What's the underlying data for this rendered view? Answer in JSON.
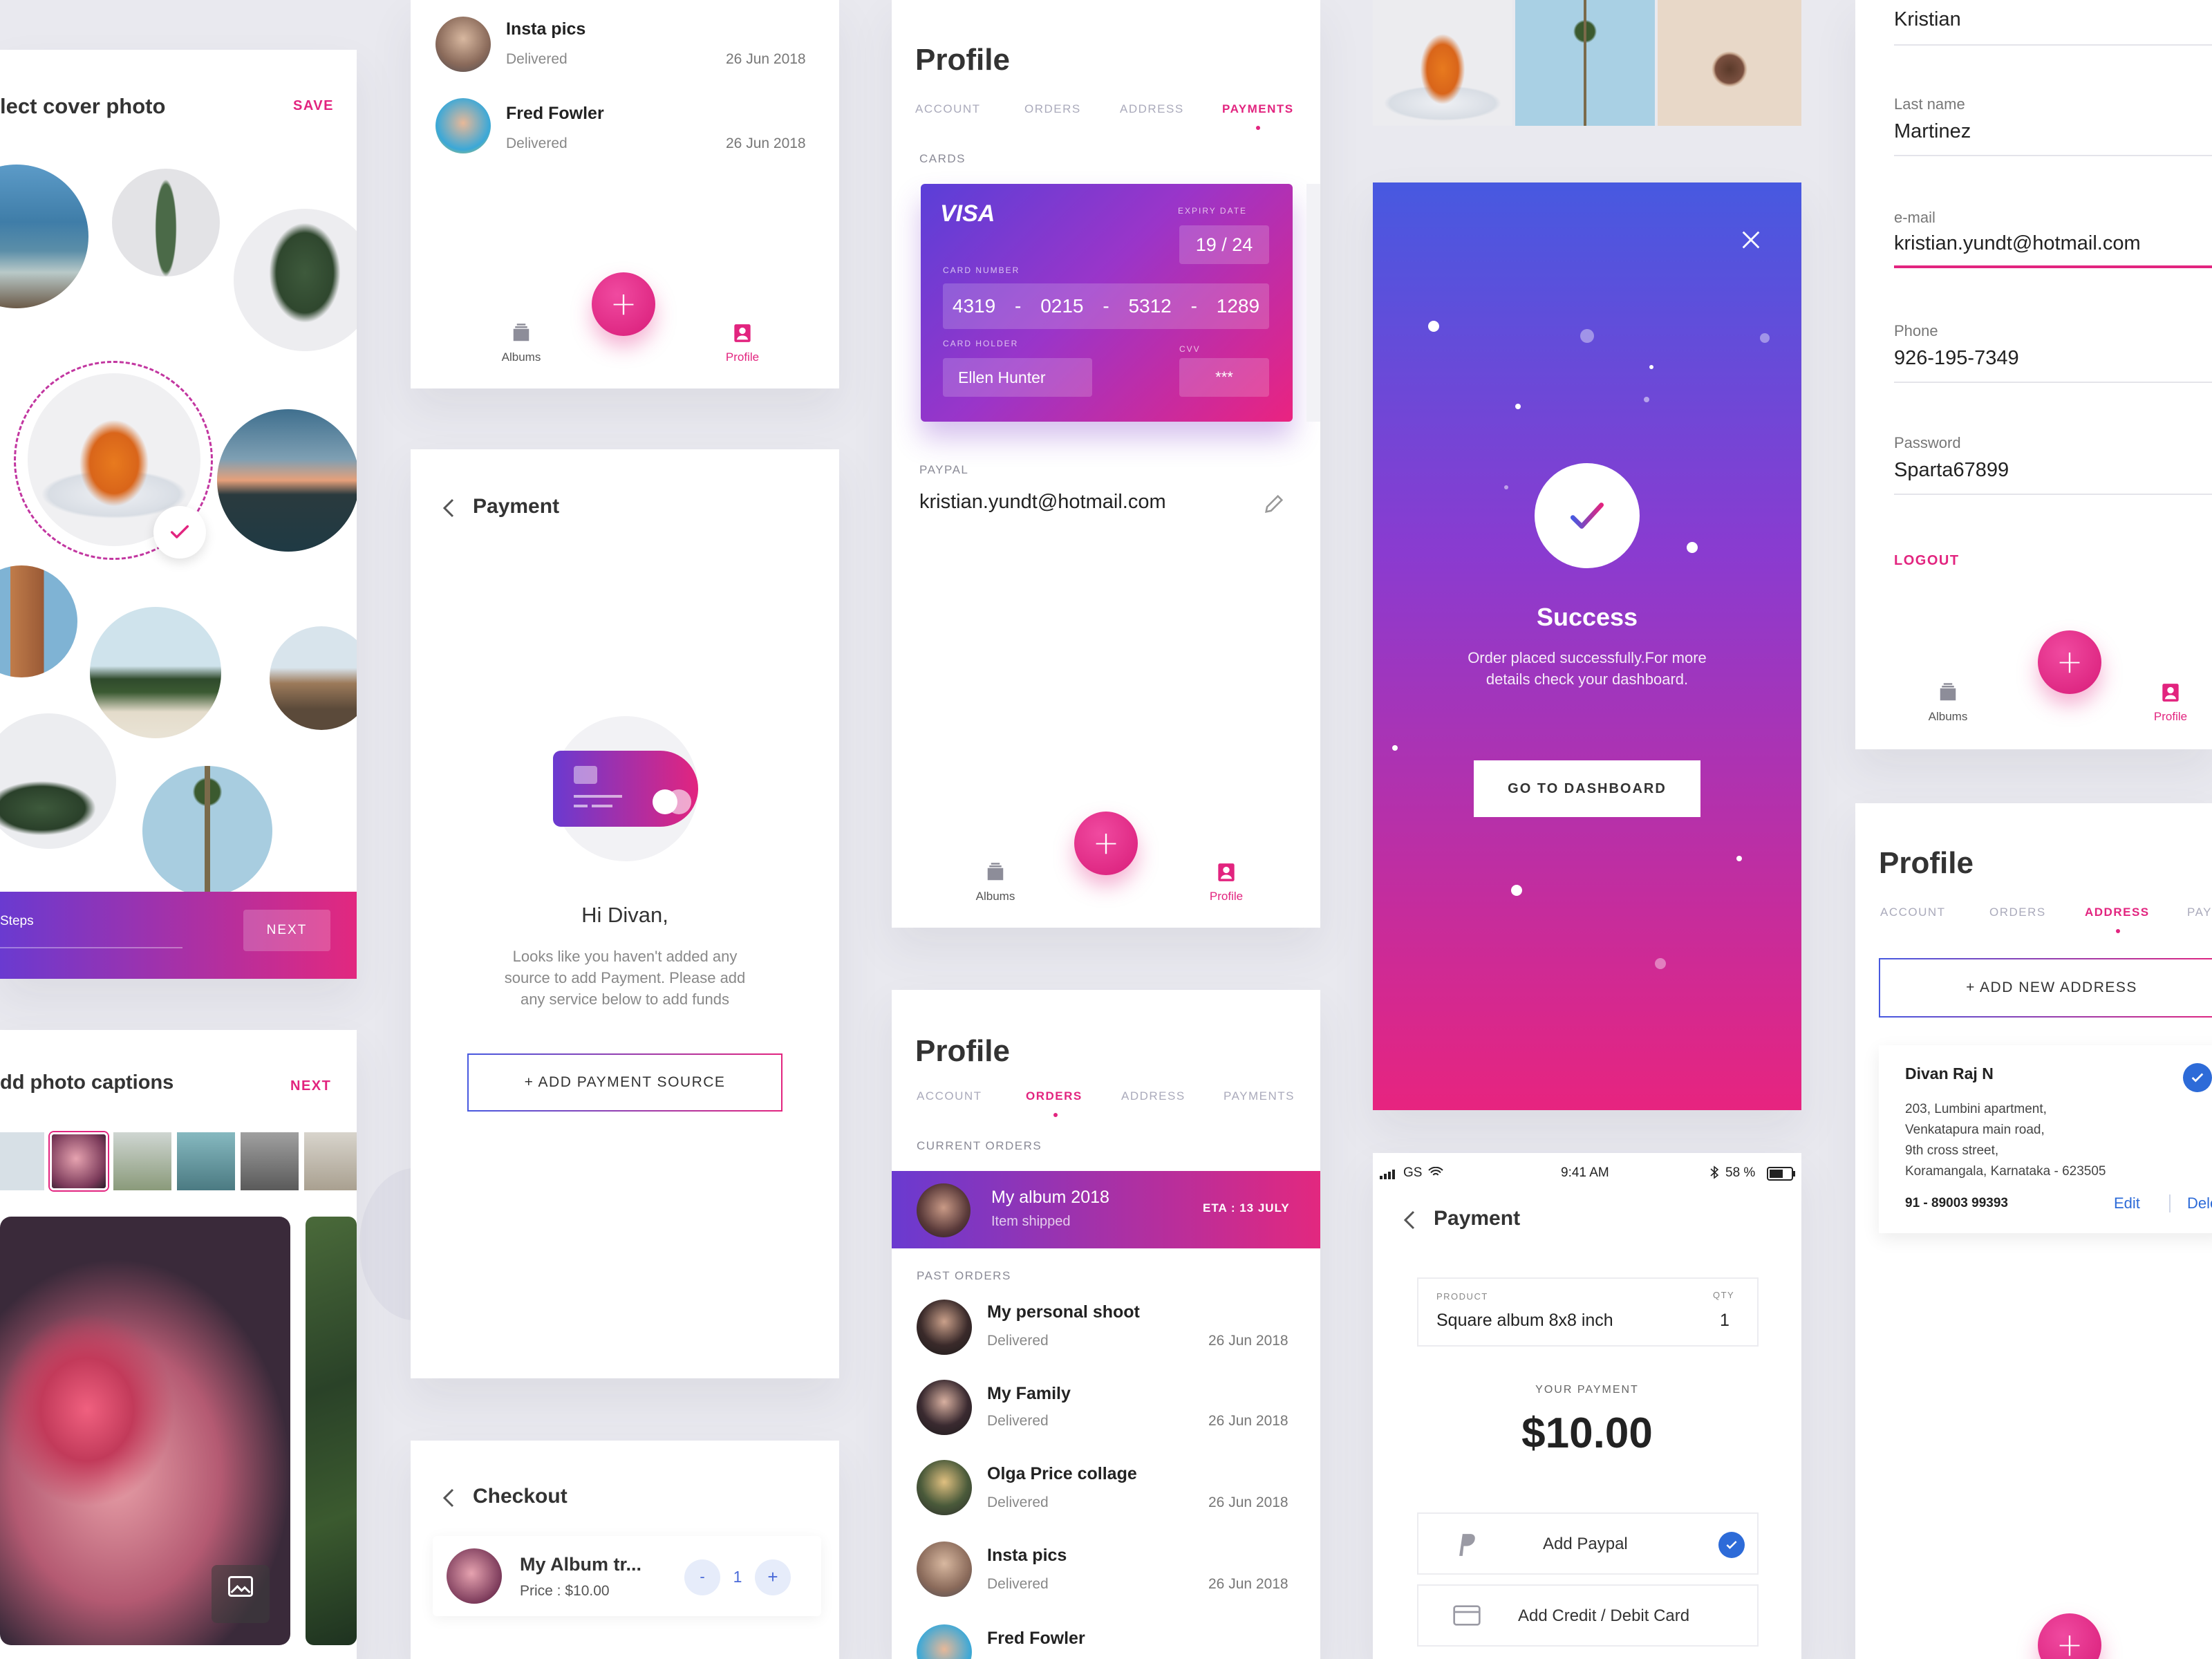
{
  "cover": {
    "title": "lect cover photo",
    "save": "SAVE",
    "steps": "Steps",
    "next": "NEXT"
  },
  "captions": {
    "title": "dd photo captions",
    "next": "NEXT"
  },
  "orders_top": {
    "rows": [
      {
        "title": "Insta pics",
        "status": "Delivered",
        "date": "26 Jun 2018"
      },
      {
        "title": "Fred Fowler",
        "status": "Delivered",
        "date": "26 Jun 2018"
      }
    ],
    "nav": {
      "albums": "Albums",
      "profile": "Profile"
    }
  },
  "payment_empty": {
    "title": "Payment",
    "greeting": "Hi Divan,",
    "message_lines": [
      "Looks like you haven't added any",
      "source to add Payment. Please add",
      "any service below to add funds"
    ],
    "button": "+ ADD PAYMENT SOURCE"
  },
  "checkout": {
    "title": "Checkout",
    "item": "My Album tr...",
    "price": "Price : $10.00",
    "qty": "1",
    "minus": "-",
    "plus": "+"
  },
  "profile_payments": {
    "title": "Profile",
    "tabs": [
      "ACCOUNT",
      "ORDERS",
      "ADDRESS",
      "PAYMENTS"
    ],
    "cards_label": "CARDS",
    "card": {
      "brand": "VISA",
      "expiry_label": "EXPIRY DATE",
      "expiry": "19 / 24",
      "number_label": "CARD NUMBER",
      "number": [
        "4319",
        "0215",
        "5312",
        "1289"
      ],
      "sep": "-",
      "holder_label": "CARD HOLDER",
      "holder": "Ellen Hunter",
      "cvv_label": "CVV",
      "cvv": "***"
    },
    "paypal_label": "PAYPAL",
    "paypal_email": "kristian.yundt@hotmail.com",
    "nav": {
      "albums": "Albums",
      "profile": "Profile"
    }
  },
  "profile_orders": {
    "title": "Profile",
    "tabs": [
      "ACCOUNT",
      "ORDERS",
      "ADDRESS",
      "PAYMENTS"
    ],
    "current_label": "CURRENT ORDERS",
    "current": {
      "title": "My album 2018",
      "status": "Item shipped",
      "eta": "ETA : 13 JULY"
    },
    "past_label": "PAST ORDERS",
    "past": [
      {
        "title": "My personal shoot",
        "status": "Delivered",
        "date": "26 Jun 2018"
      },
      {
        "title": "My Family",
        "status": "Delivered",
        "date": "26 Jun 2018"
      },
      {
        "title": "Olga Price collage",
        "status": "Delivered",
        "date": "26 Jun 2018"
      },
      {
        "title": "Insta pics",
        "status": "Delivered",
        "date": "26 Jun 2018"
      },
      {
        "title": "Fred Fowler",
        "status": "",
        "date": ""
      }
    ]
  },
  "success": {
    "title": "Success",
    "message_lines": [
      "Order placed successfully.For more",
      "details check your dashboard."
    ],
    "button": "GO TO DASHBOARD"
  },
  "payment_ios": {
    "status": {
      "carrier": "GS",
      "time": "9:41 AM",
      "battery": "58 %"
    },
    "title": "Payment",
    "product_label": "PRODUCT",
    "product": "Square album 8x8 inch",
    "qty_label": "QTY",
    "qty": "1",
    "your_payment_label": "YOUR PAYMENT",
    "amount": "$10.00",
    "options": [
      "Add Paypal",
      "Add Credit / Debit Card"
    ]
  },
  "account_form": {
    "first_name": "Kristian",
    "fields": [
      {
        "label": "Last name",
        "value": "Martinez"
      },
      {
        "label": "e-mail",
        "value": "kristian.yundt@hotmail.com"
      },
      {
        "label": "Phone",
        "value": "926-195-7349"
      },
      {
        "label": "Password",
        "value": "Sparta67899"
      }
    ],
    "logout": "LOGOUT",
    "nav": {
      "albums": "Albums",
      "profile": "Profile"
    }
  },
  "profile_address": {
    "title": "Profile",
    "tabs": [
      "ACCOUNT",
      "ORDERS",
      "ADDRESS",
      "PAY"
    ],
    "add_button": "+ ADD NEW ADDRESS",
    "address": {
      "name": "Divan Raj N",
      "lines": [
        "203, Lumbini apartment,",
        "Venkatapura main road,",
        "9th cross street,",
        "Koramangala, Karnataka - 623505"
      ],
      "phone": "91 - 89003 99393",
      "edit": "Edit",
      "delete": "Delete"
    }
  },
  "colors": {
    "accent": "#e2247f",
    "purple": "#6a3ad0",
    "blue": "#4759e0",
    "check_blue": "#2d6bd8"
  },
  "icons": [
    "check-icon",
    "back-chevron-icon",
    "close-icon",
    "plus-icon",
    "albums-icon",
    "profile-icon",
    "edit-pencil-icon",
    "image-icon",
    "paypal-icon",
    "card-icon",
    "wifi-icon",
    "bluetooth-icon",
    "battery-icon",
    "signal-icon"
  ]
}
